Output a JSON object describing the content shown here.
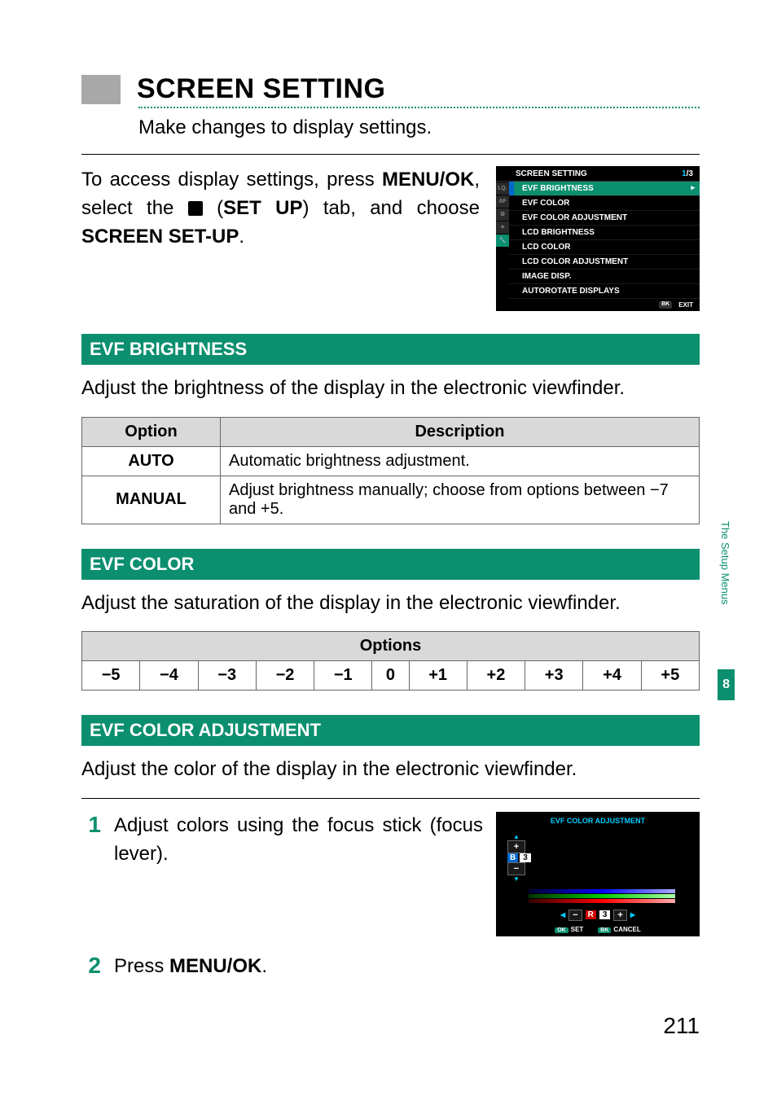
{
  "title": "SCREEN SETTING",
  "subtitle": "Make changes to display settings.",
  "intro": {
    "l1": "To access display settings, press ",
    "menuok": "MENU/OK",
    "l2": ", select the ",
    "setup_tab": "SET UP",
    "l3": ") tab, and choose ",
    "screen_setup": "SCREEN SET-UP",
    "period": "."
  },
  "menu_screenshot": {
    "header": "SCREEN SETTING",
    "page_cur": "1",
    "page_total": "/3",
    "items": [
      "EVF BRIGHTNESS",
      "EVF COLOR",
      "EVF COLOR ADJUSTMENT",
      "LCD BRIGHTNESS",
      "LCD COLOR",
      "LCD COLOR ADJUSTMENT",
      "IMAGE DISP.",
      "AUTOROTATE DISPLAYS"
    ],
    "footer_exit": "EXIT"
  },
  "sec1": {
    "heading": "EVF BRIGHTNESS",
    "desc": "Adjust the brightness of the display in the electronic viewfinder.",
    "th_option": "Option",
    "th_desc": "Description",
    "rows": [
      {
        "opt": "AUTO",
        "desc": "Automatic brightness adjustment."
      },
      {
        "opt": "MANUAL",
        "desc": "Adjust brightness manually; choose from options between −7 and +5."
      }
    ]
  },
  "sec2": {
    "heading": "EVF COLOR",
    "desc": "Adjust the saturation of the display in the electronic viewfinder.",
    "th_options": "Options",
    "range": [
      "−5",
      "−4",
      "−3",
      "−2",
      "−1",
      "0",
      "+1",
      "+2",
      "+3",
      "+4",
      "+5"
    ]
  },
  "sec3": {
    "heading": "EVF COLOR ADJUSTMENT",
    "desc": "Adjust the color of the display in the electronic viewfinder.",
    "step1_num": "1",
    "step1_text": "Adjust colors using the focus stick (focus lever).",
    "step2_num": "2",
    "step2_text_a": "Press ",
    "step2_text_b": "MENU/OK",
    "step2_text_c": "."
  },
  "adj_screenshot": {
    "title": "EVF COLOR ADJUSTMENT",
    "v_label": "B",
    "v_value": "3",
    "h_label": "R",
    "h_value": "3",
    "set": "SET",
    "cancel": "CANCEL"
  },
  "side_tab": "The Setup Menus",
  "side_badge": "8",
  "page_num": "211"
}
